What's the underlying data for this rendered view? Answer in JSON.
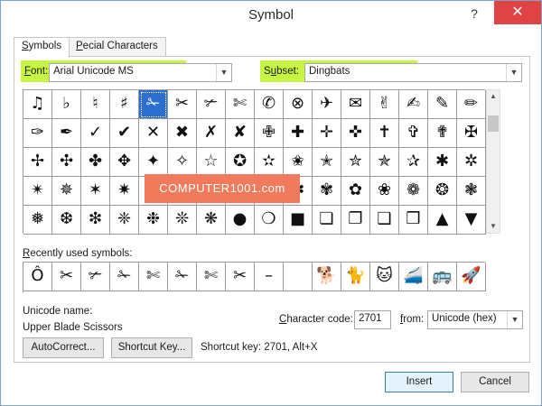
{
  "window": {
    "title": "Symbol",
    "help": "?",
    "close": "✕"
  },
  "tabs": [
    {
      "label": "Symbols",
      "accel": "S",
      "rest": "ymbols"
    },
    {
      "label": "Special Characters",
      "accel": "P",
      "pre": "S",
      "rest": "ecial Characters"
    }
  ],
  "font": {
    "label_accel": "F",
    "label_rest": "ont:",
    "value": "Arial Unicode MS"
  },
  "subset": {
    "label_pre": "S",
    "label_accel": "u",
    "label_rest": "bset:",
    "value": "Dingbats"
  },
  "grid": {
    "rows": [
      [
        "♫",
        "♭",
        "♮",
        "♯",
        "✁",
        "✂",
        "✃",
        "✄",
        "✆",
        "⊗",
        "✈",
        "✉",
        "✌",
        "✍",
        "✎",
        "✏",
        "✐"
      ],
      [
        "✑",
        "✒",
        "✓",
        "✔",
        "✕",
        "✖",
        "✗",
        "✘",
        "✙",
        "✚",
        "✛",
        "✜",
        "✝",
        "✞",
        "✟",
        "✠",
        "✡"
      ],
      [
        "✢",
        "✣",
        "✤",
        "✥",
        "✦",
        "✧",
        "☆",
        "✪",
        "✫",
        "✬",
        "✭",
        "✮",
        "✯",
        "✰",
        "✱",
        "✲",
        "✳"
      ],
      [
        "✴",
        "✵",
        "✶",
        "✷",
        "✸",
        "✹",
        "✺",
        "✻",
        "✼",
        "✽",
        "✾",
        "✿",
        "❀",
        "❁",
        "❂",
        "❃",
        "❄"
      ],
      [
        "❅",
        "❆",
        "❇",
        "❈",
        "❉",
        "❊",
        "❋",
        "●",
        "❍",
        "■",
        "❏",
        "❐",
        "❑",
        "❒",
        "▲",
        "▼",
        "◆"
      ]
    ],
    "selected_row": 0,
    "selected_col": 4
  },
  "watermark": "COMPUTER1001.com",
  "recent": {
    "label_accel": "R",
    "label_rest": "ecently used symbols:",
    "items": [
      "Ô",
      "✂",
      "✃",
      "✁",
      "✄",
      "✁",
      "✄",
      "✂",
      "–",
      "",
      "🐕",
      "🐈",
      "🐱",
      "🚄",
      "🚌",
      "🚀",
      "🚗"
    ]
  },
  "unicode_name": {
    "label": "Unicode name:",
    "value": "Upper Blade Scissors"
  },
  "charcode": {
    "label_pre": "",
    "label_accel": "C",
    "label_rest": "haracter code:",
    "value": "2701"
  },
  "from": {
    "label_accel": "f",
    "label_pre": "",
    "label_rest": "rom:",
    "value": "Unicode (hex)"
  },
  "buttons": {
    "autocorrect": "AutoCorrect...",
    "shortcut_key": "Shortcut Key...",
    "insert": "Insert",
    "cancel": "Cancel"
  },
  "shortcut_text": "Shortcut key: 2701, Alt+X",
  "colors": {
    "highlight": "#c6f542",
    "selection": "#2d6fd1",
    "close": "#e04343",
    "watermark": "#f07a5c"
  }
}
